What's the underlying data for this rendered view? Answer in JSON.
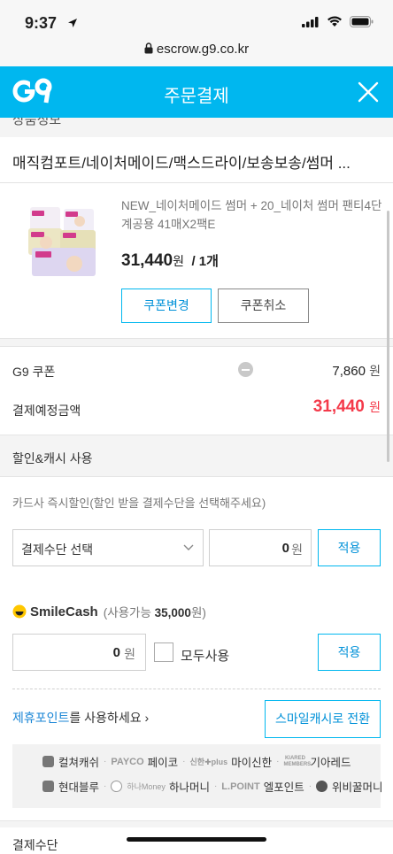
{
  "status_bar": {
    "time": "9:37"
  },
  "browser": {
    "url": "escrow.g9.co.kr"
  },
  "header": {
    "logo_text": "G9",
    "title": "주문결제"
  },
  "cutoff_text": "상품정보",
  "product": {
    "title": "매직컴포트/네이처메이드/맥스드라이/보송보송/썸머 ...",
    "option_name": "NEW_네이처메이드 썸머 + 20_네이처 썸머 팬티4단계공용 41매X2팩E",
    "price": "31,440",
    "price_unit": "원",
    "quantity": "/ 1개",
    "change_coupon_label": "쿠폰변경",
    "cancel_coupon_label": "쿠폰취소"
  },
  "summary": {
    "coupon_label": "G9 쿠폰",
    "coupon_value": "7,860",
    "coupon_unit": "원",
    "total_label": "결제예정금액",
    "total_value": "31,440",
    "total_unit": "원"
  },
  "discount_section": {
    "title": "할인&캐시 사용",
    "card_hint": "카드사 즉시할인(할인 받을 결제수단을 선택해주세요)",
    "select_placeholder": "결제수단 선택",
    "amount": "0",
    "unit": "원",
    "apply_label": "적용"
  },
  "smile_cash": {
    "logo": "SmileCash",
    "available_prefix": "(사용가능 ",
    "available_amount": "35,000",
    "available_suffix": "원)",
    "amount": "0",
    "unit": "원",
    "use_all_label": "모두사용",
    "apply_label": "적용"
  },
  "partner": {
    "link_blue": "제휴포인트",
    "link_rest": "를 사용하세요 ›",
    "convert_label": "스마일캐시로 전환",
    "row1": {
      "culture": "컬쳐캐쉬",
      "payco_brand": "PAYCO",
      "payco": "페이코",
      "shinhan_brand": "신한✚plus",
      "shinhan": "마이신한",
      "kiarmembers_brand": "KIARED MEMBERS",
      "kiared": "기아레드"
    },
    "row2": {
      "hyundai": "현대블루",
      "hana_brand": "하나Money",
      "hana": "하나머니",
      "lpoint_brand": "L.POINT",
      "lpoint": "엘포인트",
      "wibee": "위비꿀머니"
    }
  },
  "payment_method_title": "결제수단",
  "colors": {
    "brand": "#00b7ef",
    "accent_red": "#f43a4a",
    "link_blue": "#1a86d6"
  }
}
